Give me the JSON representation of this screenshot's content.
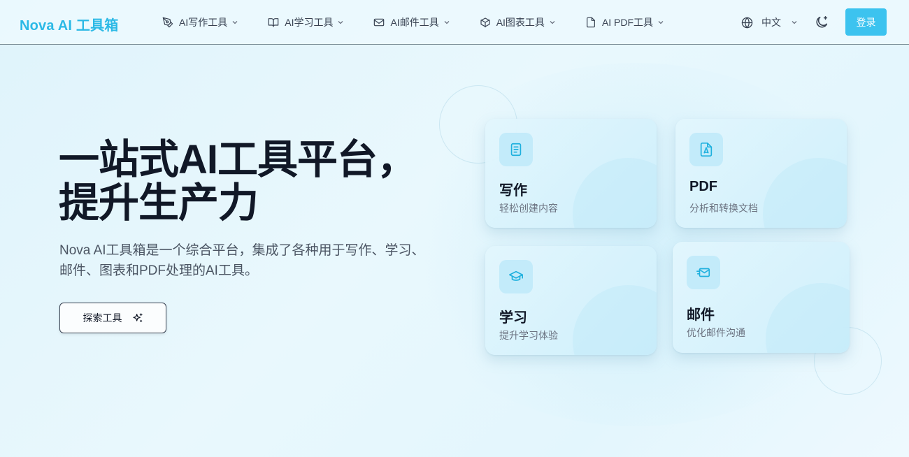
{
  "brand": "Nova AI 工具箱",
  "nav": {
    "items": [
      {
        "label": "AI写作工具",
        "icon": "pen-icon"
      },
      {
        "label": "AI学习工具",
        "icon": "book-icon"
      },
      {
        "label": "AI邮件工具",
        "icon": "mail-icon"
      },
      {
        "label": "AI图表工具",
        "icon": "cube-icon"
      },
      {
        "label": "AI PDF工具",
        "icon": "file-icon"
      }
    ],
    "language": "中文",
    "login": "登录"
  },
  "hero": {
    "title_line1": "一站式AI工具平台，",
    "title_line2": "提升生产力",
    "description": "Nova AI工具箱是一个综合平台，集成了各种用于写作、学习、邮件、图表和PDF处理的AI工具。",
    "cta": "探索工具"
  },
  "cards": [
    {
      "title": "写作",
      "subtitle": "轻松创建内容",
      "icon": "document-icon"
    },
    {
      "title": "PDF",
      "subtitle": "分析和转换文档",
      "icon": "pdf-icon"
    },
    {
      "title": "学习",
      "subtitle": "提升学习体验",
      "icon": "graduation-cap-icon"
    },
    {
      "title": "邮件",
      "subtitle": "优化邮件沟通",
      "icon": "mail-send-icon"
    }
  ],
  "colors": {
    "accent": "#3cc3ef",
    "brand": "#2bb9e6",
    "card_icon_bg": "#c3ebfa",
    "icon_stroke": "#1fb0de"
  }
}
